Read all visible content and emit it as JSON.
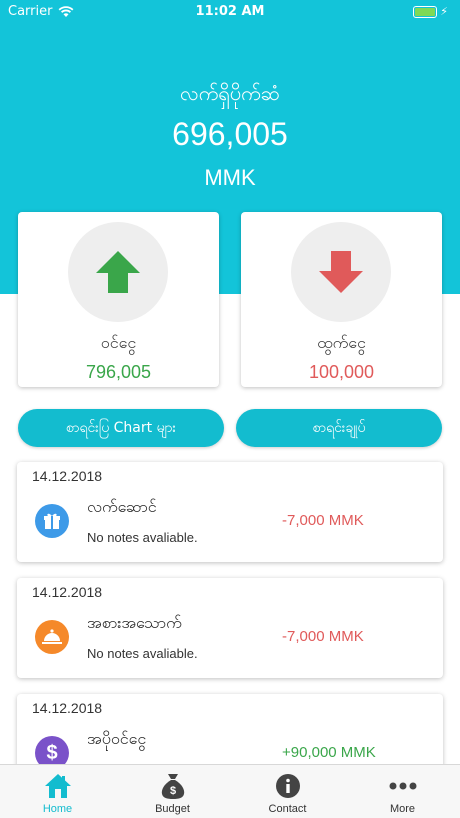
{
  "status": {
    "carrier": "Carrier",
    "time": "11:02 AM"
  },
  "balance": {
    "label": "လက်ရှိပိုက်ဆံ",
    "value": "696,005",
    "currency": "MMK"
  },
  "income": {
    "label": "ဝင်ငွေ",
    "value": "796,005",
    "color": "#3aa64a"
  },
  "expense": {
    "label": "ထွက်ငွေ",
    "value": "100,000",
    "color": "#e05a5a"
  },
  "buttons": {
    "chart": "စာရင်းပြ Chart များ",
    "summary": "စာရင်းချုပ်"
  },
  "transactions": [
    {
      "date": "14.12.2018",
      "category": "လက်ဆောင်",
      "note": "No notes avaliable.",
      "amount": "-7,000 MMK",
      "icon": "gift-icon",
      "icon_color": "#3d9ae8",
      "amount_color": "#e05a5a"
    },
    {
      "date": "14.12.2018",
      "category": "အစားအသောက်",
      "note": "No notes avaliable.",
      "amount": "-7,000 MMK",
      "icon": "food-cloche-icon",
      "icon_color": "#f5892a",
      "amount_color": "#e05a5a"
    },
    {
      "date": "14.12.2018",
      "category": "အပိုဝင်ငွေ",
      "note": "",
      "amount": "+90,000 MMK",
      "icon": "dollar-icon",
      "icon_color": "#7a52c9",
      "amount_color": "#3aa64a"
    }
  ],
  "tabs": [
    {
      "label": "Home",
      "icon": "home-icon",
      "active": true
    },
    {
      "label": "Budget",
      "icon": "money-bag-icon",
      "active": false
    },
    {
      "label": "Contact",
      "icon": "info-icon",
      "active": false
    },
    {
      "label": "More",
      "icon": "more-dots-icon",
      "active": false
    }
  ],
  "colors": {
    "accent": "#13c4d9",
    "button": "#13bccf"
  }
}
